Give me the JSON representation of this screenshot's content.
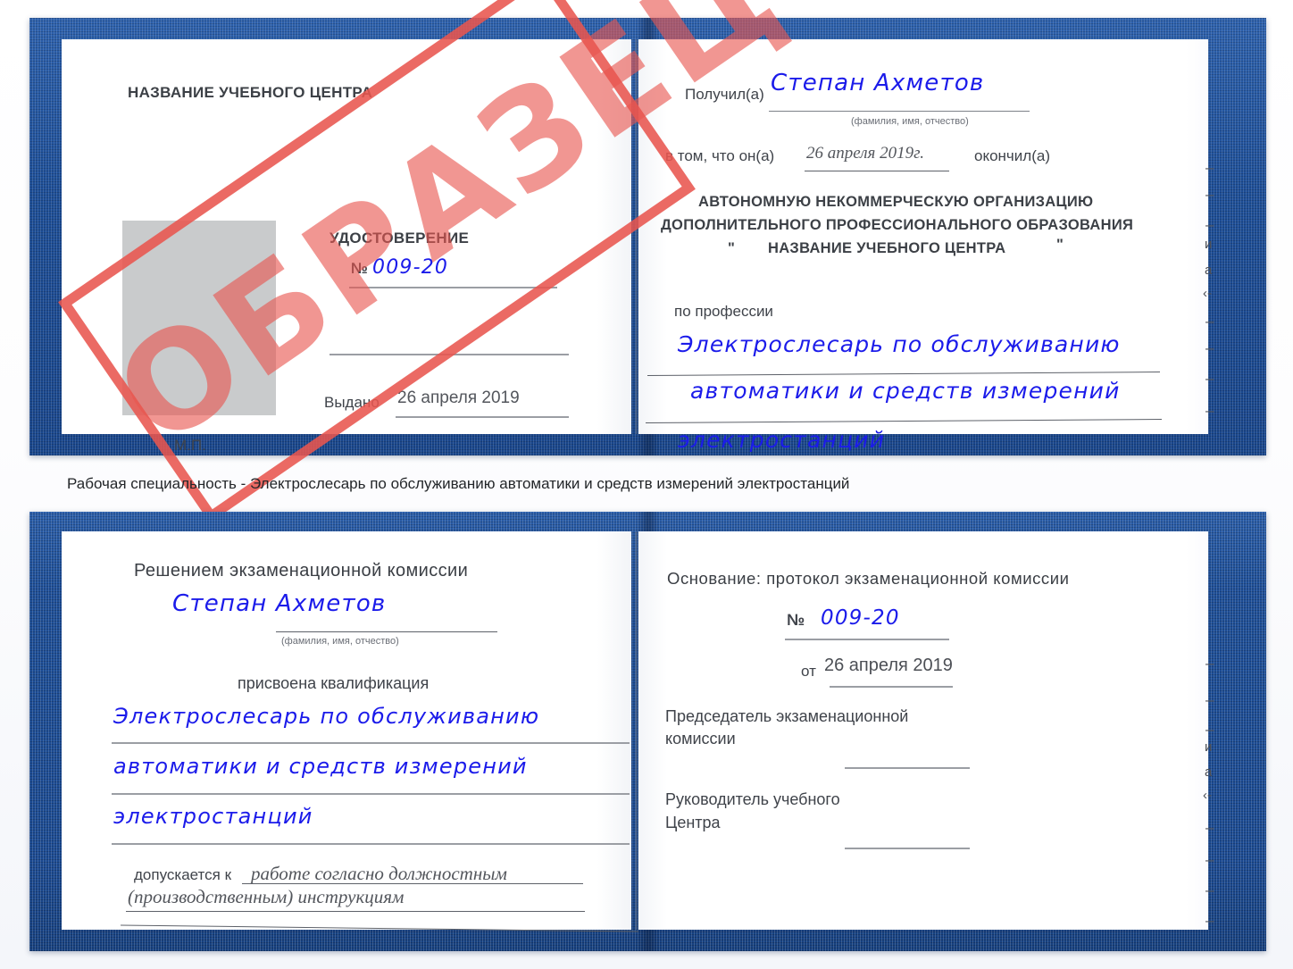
{
  "document": {
    "kind": "Удостоверение (образец)",
    "stamp_label": "ОБРАЗЕЦ",
    "stamp_color": "#e8554f",
    "cover_color": "#1d4e97",
    "handwriting_color": "#1b1bea"
  },
  "caption": {
    "text": "Рабочая специальность - Электрослесарь по обслуживанию автоматики и средств измерений электростанций"
  },
  "cert_top": {
    "left_page": {
      "center_name": "НАЗВАНИЕ УЧЕБНОГО ЦЕНТРА",
      "title": "УДОСТОВЕРЕНИЕ",
      "number_label": "№",
      "number_value": "009-20",
      "issued_label": "Выдано",
      "issued_value": "26 апреля 2019",
      "seal_label": "М.П.",
      "photo_placeholder": "photo-box"
    },
    "right_page": {
      "received_label": "Получил(а)",
      "received_value": "Степан Ахметов",
      "fio_hint": "(фамилия, имя, отчество)",
      "that_he_label": "в том, что он(а)",
      "that_he_value": "26 апреля 2019г.",
      "graduated_label": "окончил(а)",
      "org_line1": "АВТОНОМНУЮ НЕКОММЕРЧЕСКУЮ ОРГАНИЗАЦИЮ",
      "org_line2": "ДОПОЛНИТЕЛЬНОГО ПРОФЕССИОНАЛЬНОГО ОБРАЗОВАНИЯ",
      "org_quote_open": "\"",
      "org_line3": "НАЗВАНИЕ УЧЕБНОГО ЦЕНТРА",
      "org_quote_close": "\"",
      "profession_label": "по профессии",
      "profession_line1": "Электрослесарь по обслуживанию",
      "profession_line2": "автоматики и средств измерений",
      "profession_line3": "электростанций",
      "edge_fragments": [
        "–",
        "–",
        "–",
        "и",
        "а",
        "‹-",
        "–",
        "–",
        "–",
        "–"
      ]
    }
  },
  "cert_bottom": {
    "left_page": {
      "heading": "Решением экзаменационной комиссии",
      "name_value": "Степан Ахметов",
      "fio_hint": "(фамилия, имя, отчество)",
      "qualification_label": "присвоена квалификация",
      "qualification_line1": "Электрослесарь по обслуживанию",
      "qualification_line2": "автоматики и средств измерений",
      "qualification_line3": "электростанций",
      "admitted_label": "допускается к",
      "admitted_line1": "работе согласно должностным",
      "admitted_line2": "(производственным) инструкциям"
    },
    "right_page": {
      "basis_label": "Основание: протокол экзаменационной комиссии",
      "number_label": "№",
      "number_value": "009-20",
      "date_label": "от",
      "date_value": "26 апреля 2019",
      "chairman_line1": "Председатель экзаменационной",
      "chairman_line2": "комиссии",
      "head_line1": "Руководитель учебного",
      "head_line2": "Центра",
      "edge_fragments": [
        "–",
        "–",
        "–",
        "и",
        "а",
        "‹-",
        "–",
        "–",
        "–",
        "–"
      ]
    }
  }
}
